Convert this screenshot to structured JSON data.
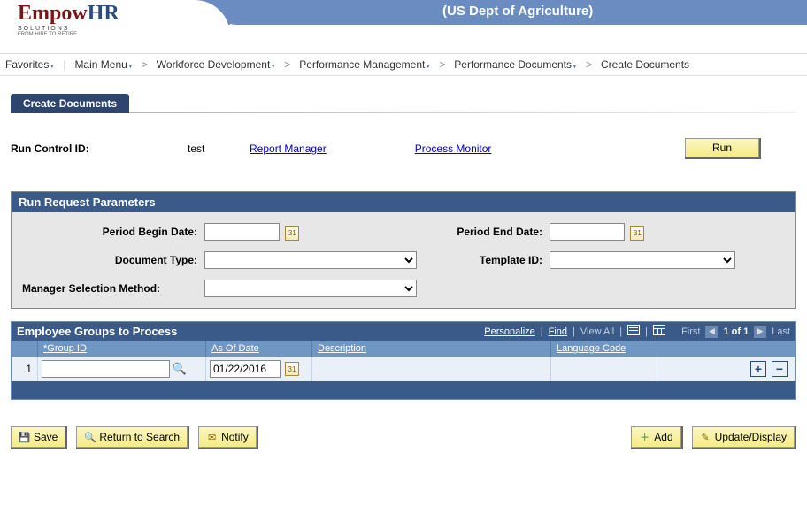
{
  "header": {
    "org": "(US Dept of Agriculture)",
    "logo": {
      "main": "Empow",
      "hr": "HR",
      "sub1": "SOLUTIONS",
      "sub2": "FROM HIRE TO RETIRE"
    }
  },
  "breadcrumb": {
    "favorites": "Favorites",
    "mainmenu": "Main Menu",
    "items": [
      "Workforce Development",
      "Performance Management",
      "Performance Documents",
      "Create Documents"
    ]
  },
  "tab_label": "Create Documents",
  "run_control": {
    "label": "Run Control ID:",
    "value": "test",
    "report_manager": "Report Manager",
    "process_monitor": "Process Monitor",
    "run_btn": "Run"
  },
  "params": {
    "title": "Run Request Parameters",
    "period_begin_label": "Period Begin Date:",
    "period_begin_value": "",
    "period_end_label": "Period End Date:",
    "period_end_value": "",
    "doc_type_label": "Document Type:",
    "template_id_label": "Template ID:",
    "mgr_sel_label": "Manager Selection Method:"
  },
  "grid": {
    "title": "Employee Groups to Process",
    "personalize": "Personalize",
    "find": "Find",
    "viewall": "View All",
    "first": "First",
    "counter": "1 of 1",
    "last": "Last",
    "cols": {
      "group_id": "*Group ID",
      "as_of_date": "As Of Date",
      "description": "Description",
      "language_code": "Language Code"
    },
    "rows": [
      {
        "n": "1",
        "group_id": "",
        "as_of_date": "01/22/2016",
        "description": "",
        "language_code": ""
      }
    ]
  },
  "actions": {
    "save": "Save",
    "return": "Return to Search",
    "notify": "Notify",
    "add": "Add",
    "update": "Update/Display"
  }
}
